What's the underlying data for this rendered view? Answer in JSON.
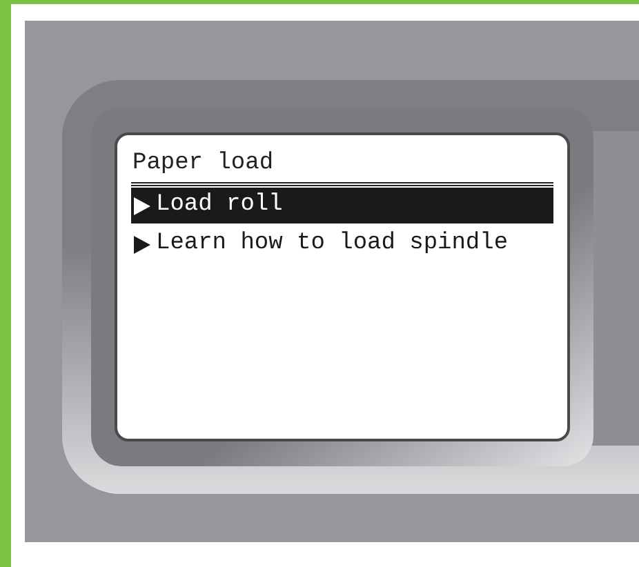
{
  "screen": {
    "title": "Paper load",
    "items": [
      {
        "label": "Load roll",
        "selected": true
      },
      {
        "label": "Learn how to load spindle",
        "selected": false
      }
    ]
  }
}
